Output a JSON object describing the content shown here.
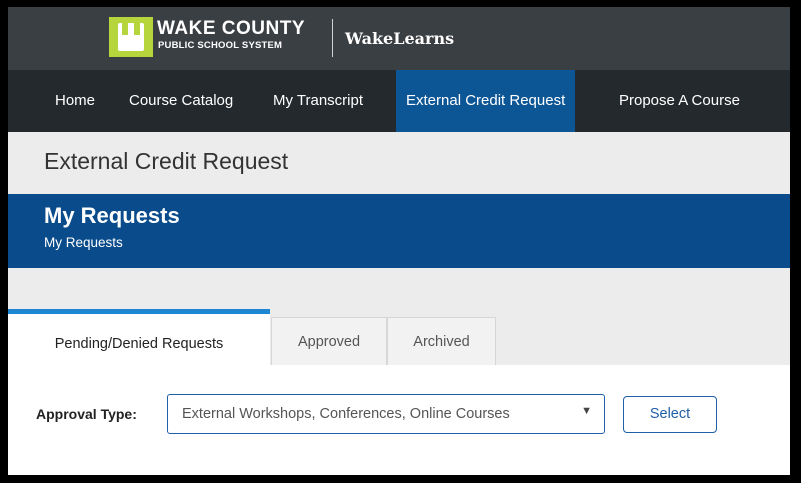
{
  "header": {
    "org_line1": "WAKE COUNTY",
    "org_line2": "PUBLIC SCHOOL SYSTEM",
    "brand": "WakeLearns",
    "logo_icon": "wcpss-logo-icon"
  },
  "nav": {
    "items": [
      {
        "label": "Home"
      },
      {
        "label": "Course Catalog"
      },
      {
        "label": "My Transcript"
      },
      {
        "label": "External Credit Request",
        "active": true
      },
      {
        "label": "Propose A Course"
      }
    ]
  },
  "page": {
    "title": "External Credit Request"
  },
  "section": {
    "title": "My Requests",
    "subtitle": "My Requests"
  },
  "tabs": [
    {
      "label": "Pending/Denied Requests",
      "active": true
    },
    {
      "label": "Approved"
    },
    {
      "label": "Archived"
    }
  ],
  "filter": {
    "label": "Approval Type:",
    "selected": "External Workshops, Conferences, Online Courses",
    "button": "Select"
  },
  "colors": {
    "topbar": "#3a3f44",
    "nav": "#24292d",
    "nav_active": "#0d5696",
    "section_bar": "#0a4c8b",
    "logo_green": "#b6d43b",
    "tab_active_accent": "#1f87d1"
  }
}
